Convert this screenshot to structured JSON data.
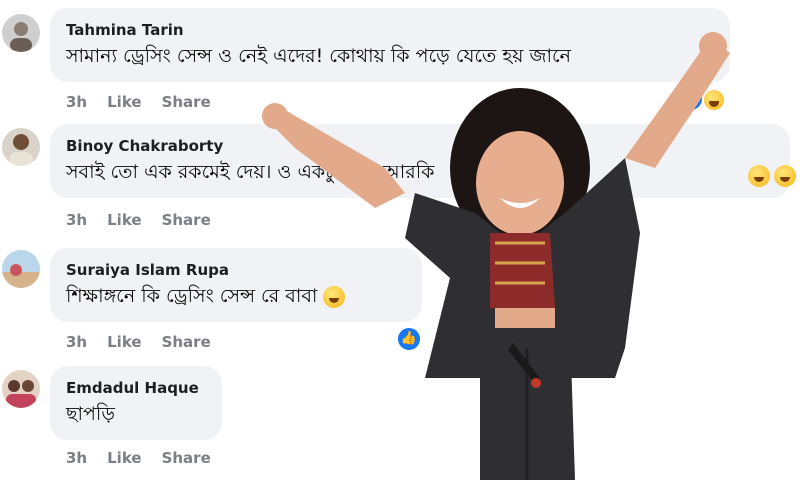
{
  "comments": [
    {
      "author": "Tahmina Tarin",
      "text": "সামান্য ড্রেসিং সেন্স ও নেই এদের! কোথায় কি পড়ে যেতে হয় জানে",
      "time": "3h",
      "like": "Like",
      "share": "Share"
    },
    {
      "author": "Binoy Chakraborty",
      "text": "সবাই তো এক রকমেই দেয়। ও একটু অ… আরকি",
      "time": "3h",
      "like": "Like",
      "share": "Share"
    },
    {
      "author": "Suraiya Islam Rupa",
      "text": "শিক্ষাঙ্গনে কি ড্রেসিং সেন্স রে বাবা",
      "time": "3h",
      "like": "Like",
      "share": "Share"
    },
    {
      "author": "Emdadul Haque",
      "text": "ছাপড়ি",
      "time": "3h",
      "like": "Like",
      "share": "Share"
    }
  ],
  "colors": {
    "bubble": "#f0f2f5",
    "meta": "#7b7f86",
    "like_blue": "#1877f2",
    "jacket": "#2f2f33"
  },
  "icons": [
    "like-reaction-icon",
    "haha-reaction-icon",
    "laugh-emoji-icon"
  ]
}
